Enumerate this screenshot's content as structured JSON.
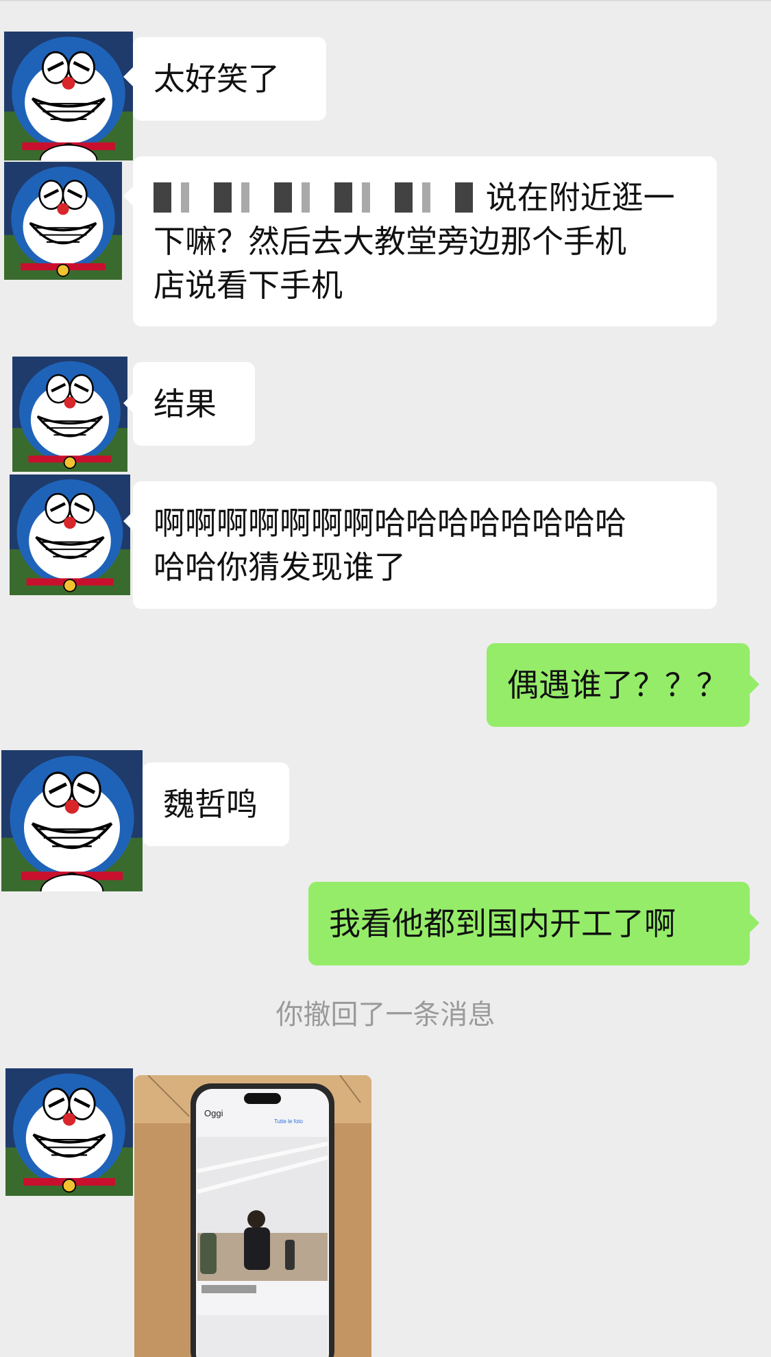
{
  "messages": [
    {
      "type": "text",
      "side": "in",
      "text": "太好笑了"
    },
    {
      "type": "text",
      "side": "in",
      "line1_suffix": "说在附近逛一",
      "line2": "下嘛？然后去大教堂旁边那个手机",
      "line3": "店说看下手机"
    },
    {
      "type": "text",
      "side": "in",
      "text": "结果"
    },
    {
      "type": "text",
      "side": "in",
      "line1": "啊啊啊啊啊啊啊哈哈哈哈哈哈哈哈",
      "line2": "哈哈你猜发现谁了"
    },
    {
      "type": "text",
      "side": "out",
      "text": "偶遇谁了？？？"
    },
    {
      "type": "text",
      "side": "in",
      "text": "魏哲鸣"
    },
    {
      "type": "text",
      "side": "out",
      "text": "我看他都到国内开工了啊"
    },
    {
      "type": "system",
      "text": "你撤回了一条消息"
    },
    {
      "type": "image",
      "side": "in"
    }
  ],
  "photo_screen": {
    "app_title": "Oggi",
    "link_label": "Tutte le foto"
  },
  "colors": {
    "background": "#ededed",
    "incoming_bubble": "#ffffff",
    "outgoing_bubble": "#95ec69",
    "system_text": "#9a9a9a"
  },
  "icons": [
    "doraemon-avatar"
  ]
}
